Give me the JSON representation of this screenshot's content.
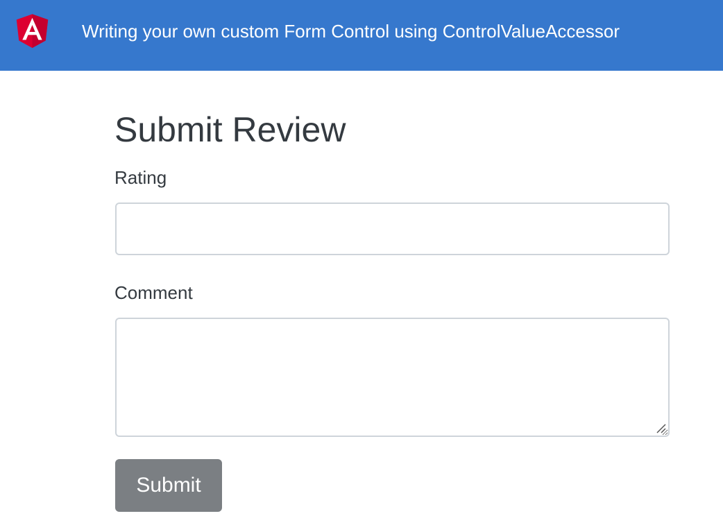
{
  "header": {
    "logo_icon": "angular-logo-icon",
    "title": "Writing your own custom Form Control using ControlValueAccessor",
    "background_color": "#3678cd"
  },
  "form": {
    "heading": "Submit Review",
    "rating": {
      "label": "Rating",
      "value": ""
    },
    "comment": {
      "label": "Comment",
      "value": ""
    },
    "submit_label": "Submit",
    "submit_color": "#7b7f83"
  }
}
